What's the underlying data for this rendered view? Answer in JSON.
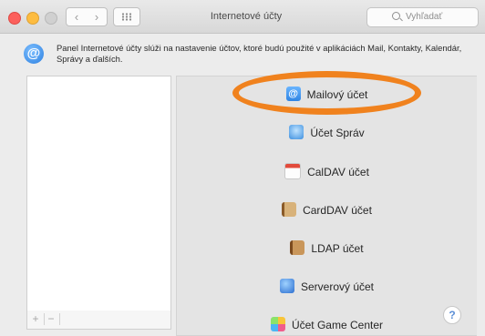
{
  "window": {
    "title": "Internetové účty",
    "search_placeholder": "Vyhľadať",
    "nav_back": "‹",
    "nav_forward": "›"
  },
  "info": {
    "icon": "@",
    "text": "Panel Internetové účty slúži na nastavenie účtov, ktoré budú použité v aplikáciách Mail, Kontakty, Kalendár, Správy a ďalších."
  },
  "accounts_list": {
    "add_label": "+",
    "remove_label": "−"
  },
  "account_types": [
    {
      "label": "Mailový účet",
      "icon": "mail-at-icon"
    },
    {
      "label": "Účet Správ",
      "icon": "messages-icon"
    },
    {
      "label": "CalDAV účet",
      "icon": "calendar-icon"
    },
    {
      "label": "CardDAV účet",
      "icon": "contacts-book-icon"
    },
    {
      "label": "LDAP účet",
      "icon": "address-book-icon"
    },
    {
      "label": "Serverový účet",
      "icon": "globe-server-icon"
    },
    {
      "label": "Účet Game Center",
      "icon": "game-center-icon"
    }
  ],
  "help_label": "?",
  "highlight_color": "#f0821e"
}
